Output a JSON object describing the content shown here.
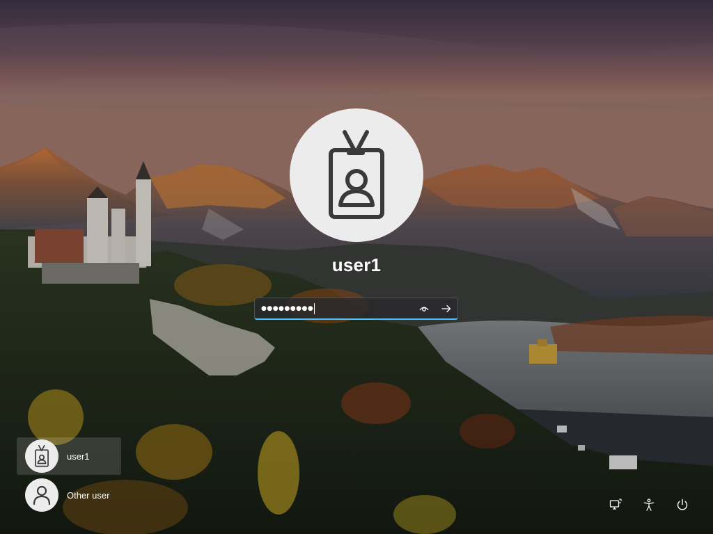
{
  "lock_screen": {
    "current_user": "user1",
    "password_masked": "●●●●●●●●●",
    "icons": {
      "avatar": "badge-person-icon",
      "reveal": "eye-icon",
      "submit": "arrow-right-icon"
    }
  },
  "user_list": [
    {
      "name": "user1",
      "icon": "badge-person-icon",
      "selected": true
    },
    {
      "name": "Other user",
      "icon": "person-icon",
      "selected": false
    }
  ],
  "system_buttons": [
    {
      "label": "Network",
      "icon": "network-icon"
    },
    {
      "label": "Accessibility",
      "icon": "accessibility-icon"
    },
    {
      "label": "Power",
      "icon": "power-icon"
    }
  ],
  "colors": {
    "accent": "#4cc2ff",
    "avatar_bg": "#ececec",
    "icon_dark": "#3a3a3a",
    "text": "#ffffff"
  }
}
